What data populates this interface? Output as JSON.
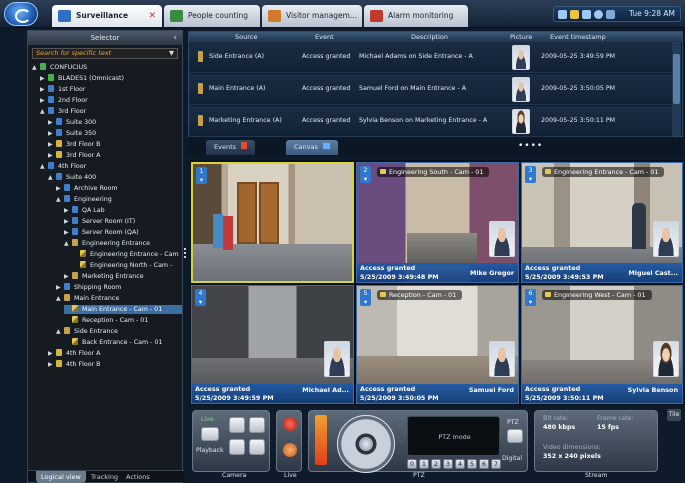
{
  "app": {
    "tabs": [
      {
        "label": "Surveillance",
        "icon": "surveillance-icon",
        "color": "#2f6fc6",
        "active": true
      },
      {
        "label": "People counting",
        "icon": "people-counting-icon",
        "color": "#3a8a3f",
        "active": false
      },
      {
        "label": "Visitor managem...",
        "icon": "visitor-icon",
        "color": "#d07a2a",
        "active": false
      },
      {
        "label": "Alarm monitoring",
        "icon": "alarm-icon",
        "color": "#c0392b",
        "active": false
      }
    ],
    "clock": "Tue 9:28 AM"
  },
  "selector": {
    "title": "Selector",
    "search_placeholder": "Search for specific text",
    "tree": [
      {
        "label": "CONFUCIUS",
        "depth": 0,
        "icon": "green",
        "exp": "▲"
      },
      {
        "label": "BLADES1 (Omnicast)",
        "depth": 1,
        "icon": "green",
        "exp": "▶"
      },
      {
        "label": "1st Floor",
        "depth": 1,
        "icon": "blue",
        "exp": "▶"
      },
      {
        "label": "2nd Floor",
        "depth": 1,
        "icon": "blue",
        "exp": "▶"
      },
      {
        "label": "3rd Floor",
        "depth": 1,
        "icon": "blue",
        "exp": "▲"
      },
      {
        "label": "Suite 300",
        "depth": 2,
        "icon": "blue",
        "exp": "▶"
      },
      {
        "label": "Suite 350",
        "depth": 2,
        "icon": "blue",
        "exp": "▶"
      },
      {
        "label": "3rd Floor B",
        "depth": 2,
        "icon": "yellow",
        "exp": "▶"
      },
      {
        "label": "3rd Floor A",
        "depth": 2,
        "icon": "yellow",
        "exp": "▶"
      },
      {
        "label": "4th Floor",
        "depth": 1,
        "icon": "blue",
        "exp": "▲"
      },
      {
        "label": "Suite 400",
        "depth": 2,
        "icon": "blue",
        "exp": "▲"
      },
      {
        "label": "Archive Room",
        "depth": 3,
        "icon": "blue",
        "exp": "▶"
      },
      {
        "label": "Engineering",
        "depth": 3,
        "icon": "blue",
        "exp": "▲"
      },
      {
        "label": "QA Lab",
        "depth": 4,
        "icon": "blue",
        "exp": "▶"
      },
      {
        "label": "Server Room (IT)",
        "depth": 4,
        "icon": "blue",
        "exp": "▶"
      },
      {
        "label": "Server Room (QA)",
        "depth": 4,
        "icon": "blue",
        "exp": "▶"
      },
      {
        "label": "Engineering Entrance",
        "depth": 4,
        "icon": "door",
        "exp": "▲"
      },
      {
        "label": "Engineering Entrance - Cam",
        "depth": 5,
        "icon": "cam",
        "exp": ""
      },
      {
        "label": "Engineering North - Cam -",
        "depth": 5,
        "icon": "cam",
        "exp": ""
      },
      {
        "label": "Marketing Entrance",
        "depth": 4,
        "icon": "door",
        "exp": "▶"
      },
      {
        "label": "Shipping Room",
        "depth": 3,
        "icon": "blue",
        "exp": "▶"
      },
      {
        "label": "Main Entrance",
        "depth": 3,
        "icon": "door",
        "exp": "▲"
      },
      {
        "label": "Main Entrance - Cam - 01",
        "depth": 4,
        "icon": "cam",
        "exp": "",
        "selected": true
      },
      {
        "label": "Reception - Cam - 01",
        "depth": 4,
        "icon": "cam",
        "exp": ""
      },
      {
        "label": "Side Entrance",
        "depth": 3,
        "icon": "door",
        "exp": "▲"
      },
      {
        "label": "Back Entrance - Cam - 01",
        "depth": 4,
        "icon": "cam",
        "exp": ""
      },
      {
        "label": "4th Floor A",
        "depth": 2,
        "icon": "yellow",
        "exp": "▶"
      },
      {
        "label": "4th Floor B",
        "depth": 2,
        "icon": "yellow",
        "exp": "▶"
      }
    ],
    "bottom_tabs": [
      "Logical view",
      "Tracking",
      "Actions"
    ]
  },
  "events": {
    "columns": [
      "Source",
      "Event",
      "Description",
      "Picture",
      "Event timestamp"
    ],
    "rows": [
      {
        "source": "Side Entrance (A)",
        "event": "Access granted",
        "description": "Michael Adams on Side Entrance - A",
        "timestamp": "2009-05-25 3:49:59 PM"
      },
      {
        "source": "Main Entrance (A)",
        "event": "Access granted",
        "description": "Samuel Ford on Main Entrance - A",
        "timestamp": "2009-05-25 3:50:05 PM"
      },
      {
        "source": "Marketing Entrance (A)",
        "event": "Access granted",
        "description": "Sylvia Benson on Marketing Entrance - A",
        "timestamp": "2009-05-25 3:50:11 PM"
      }
    ]
  },
  "strip": {
    "events_tab": "Events",
    "canvas_tab": "Canvas",
    "dots": "••••"
  },
  "tiles": [
    {
      "num": "1",
      "cam": "",
      "status": "",
      "time": "",
      "person": ""
    },
    {
      "num": "2",
      "cam": "Engineering South - Cam - 01",
      "status": "Access granted",
      "time": "5/25/2009 3:49:48 PM",
      "person": "Mike Gregor"
    },
    {
      "num": "3",
      "cam": "Engineering Entrance - Cam - 01",
      "status": "Access granted",
      "time": "5/25/2009 3:49:53 PM",
      "person": "Miguel Cast..."
    },
    {
      "num": "4",
      "cam": "",
      "status": "Access granted",
      "time": "5/25/2009 3:49:59 PM",
      "person": "Michael Ad..."
    },
    {
      "num": "5",
      "cam": "Reception - Cam - 01",
      "status": "Access granted",
      "time": "5/25/2009 3:50:05 PM",
      "person": "Samuel Ford"
    },
    {
      "num": "6",
      "cam": "Engineering West - Cam - 01",
      "status": "Access granted",
      "time": "5/25/2009 3:50:11 PM",
      "person": "Sylvia Benson"
    }
  ],
  "controls": {
    "camera_label": "Camera",
    "live_label": "Live",
    "playback_label": "Playback",
    "live_panel_label": "Live",
    "ptz_label": "PTZ",
    "ptz_mode": "PTZ mode",
    "ptz_small": "PTZ",
    "digital": "Digital",
    "presets": [
      "0",
      "1",
      "2",
      "3",
      "4",
      "5",
      "6",
      "7"
    ],
    "stream": {
      "label": "Stream",
      "bitrate_label": "Bit rate:",
      "bitrate": "480 kbps",
      "framerate_label": "Frame rate:",
      "framerate": "15 fps",
      "dims_label": "Video dimensions:",
      "dims": "352 x 240 pixels"
    },
    "tile_side": "Tile"
  }
}
